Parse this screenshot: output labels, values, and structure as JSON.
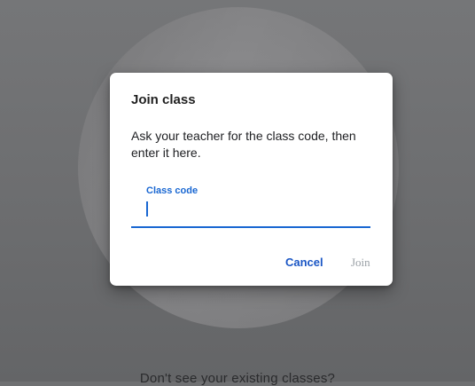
{
  "dialog": {
    "title": "Join class",
    "body": "Ask your teacher for the class code, then enter it here.",
    "field": {
      "label": "Class code",
      "value": "",
      "placeholder": ""
    },
    "cancel_label": "Cancel",
    "join_label": "Join"
  },
  "footer": {
    "text": "Don't see your existing classes?"
  },
  "colors": {
    "accent": "#1967d2",
    "disabled": "#9aa0a6",
    "overlay": "#6f7072"
  }
}
